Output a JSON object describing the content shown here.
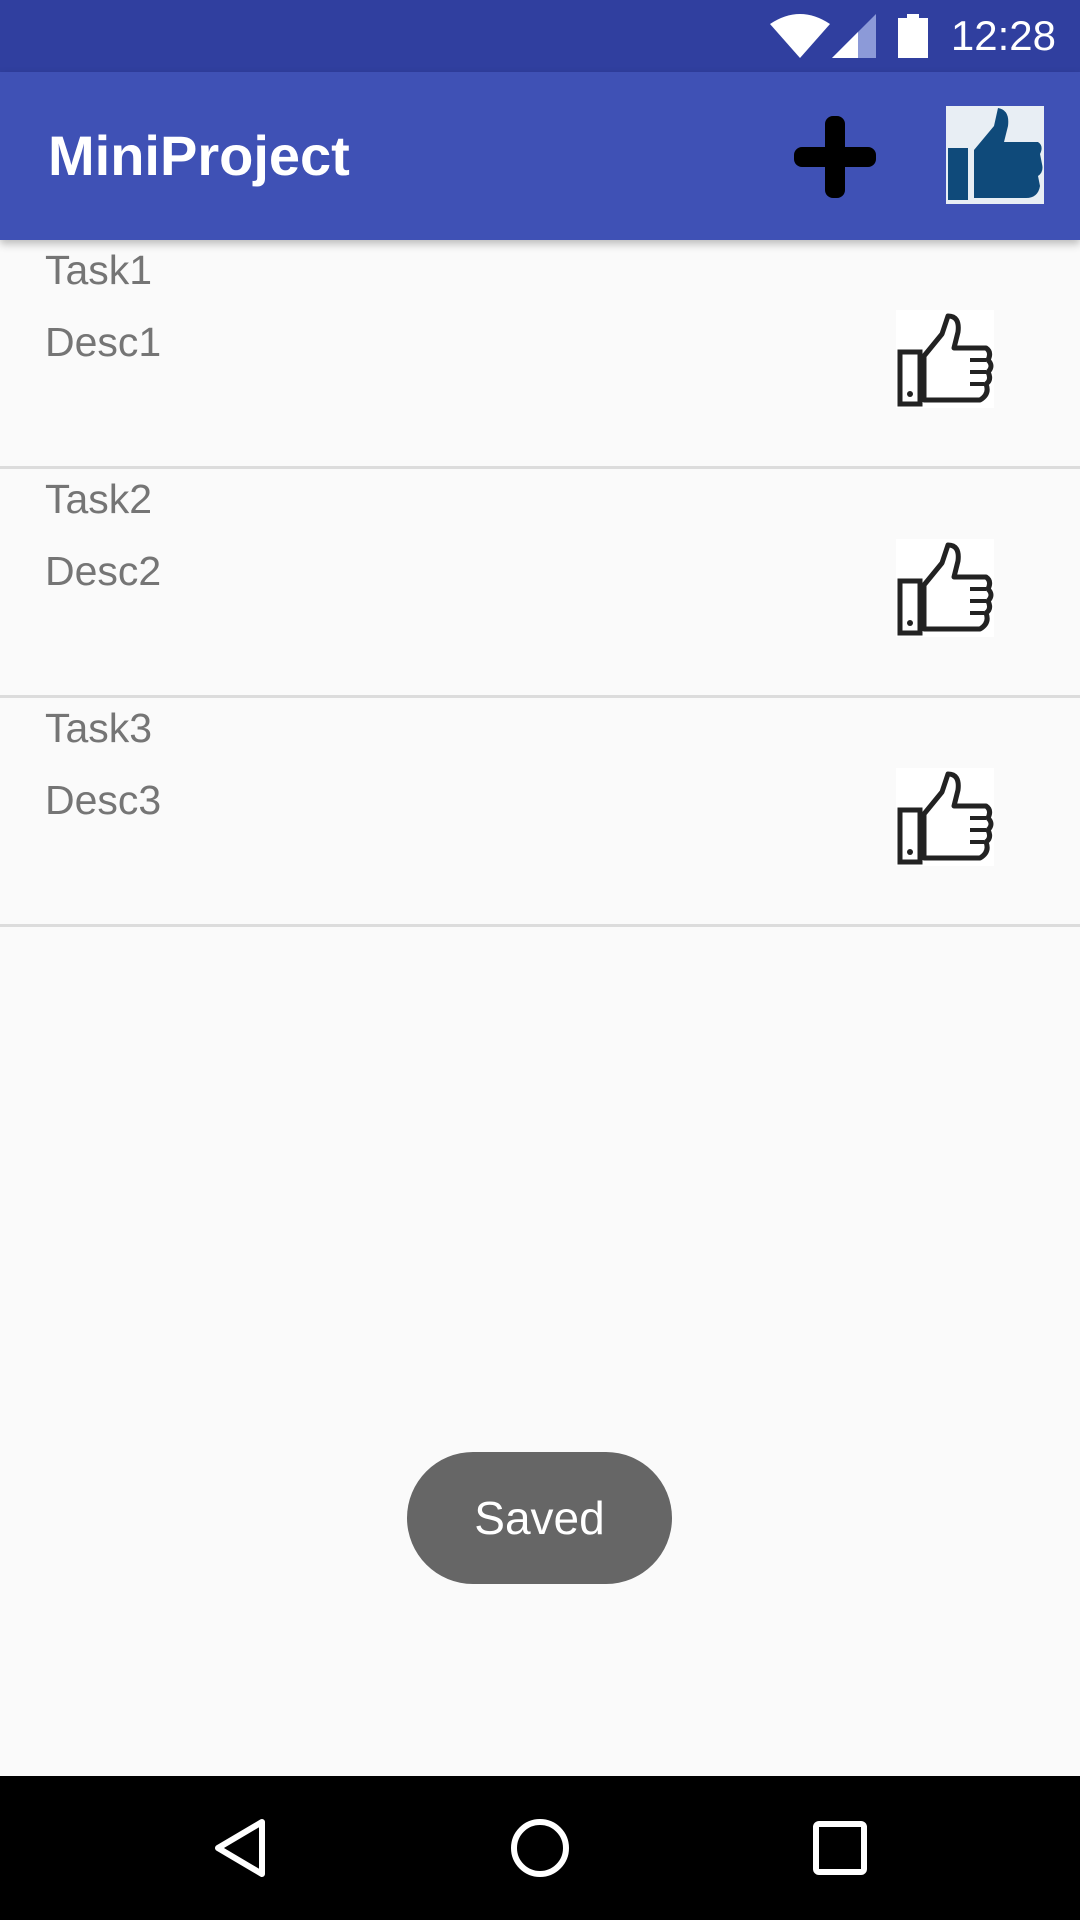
{
  "status_bar": {
    "time": "12:28",
    "icons": [
      "wifi-icon",
      "cell-signal-icon",
      "battery-icon"
    ],
    "color": "#303f9f"
  },
  "app_bar": {
    "title": "MiniProject",
    "color": "#3f51b5",
    "actions": [
      "add-icon",
      "thumbs-up-icon"
    ]
  },
  "tasks": [
    {
      "title": "Task1",
      "description": "Desc1",
      "icon": "thumbs-up-outline-icon"
    },
    {
      "title": "Task2",
      "description": "Desc2",
      "icon": "thumbs-up-outline-icon"
    },
    {
      "title": "Task3",
      "description": "Desc3",
      "icon": "thumbs-up-outline-icon"
    }
  ],
  "toast": {
    "message": "Saved"
  },
  "nav_bar": {
    "buttons": [
      "back-icon",
      "home-icon",
      "recents-icon"
    ]
  }
}
